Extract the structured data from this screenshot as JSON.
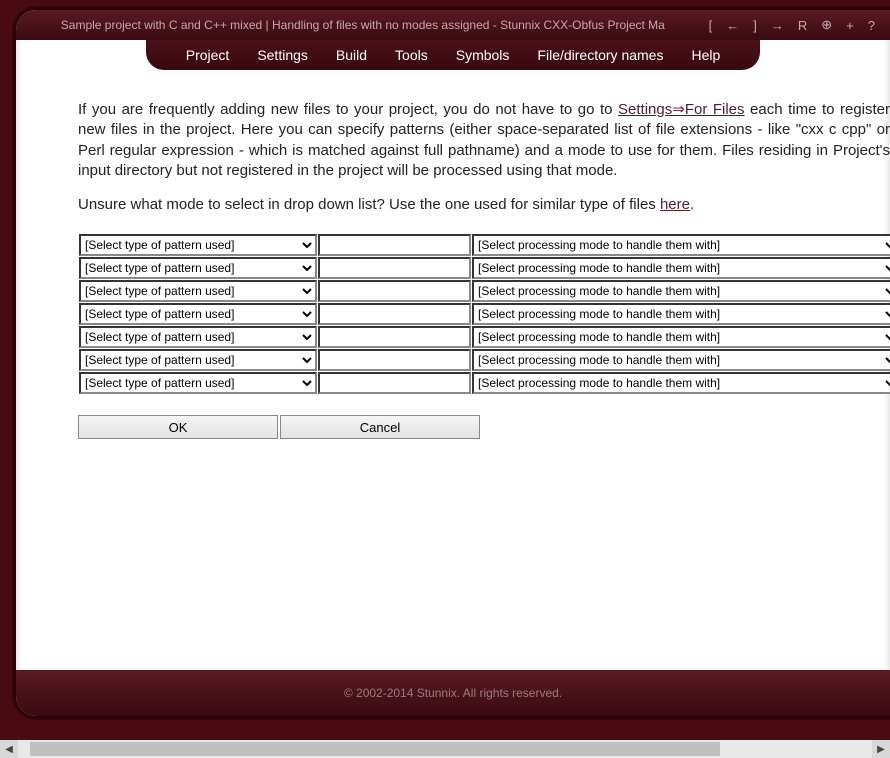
{
  "title": "Sample project with C and C++ mixed | Handling of files with no modes assigned - Stunnix CXX-Obfus Project Ma",
  "title_icons": [
    "[",
    "←",
    "]",
    "→",
    "R",
    "⊕",
    "+",
    "?"
  ],
  "menu": [
    "Project",
    "Settings",
    "Build",
    "Tools",
    "Symbols",
    "File/directory names",
    "Help"
  ],
  "para1_a": "If you are frequently adding new files to your project, you do not have to go to ",
  "para1_link": "Settings⇒For Files",
  "para1_b": " each time to register new files in the project. Here you can specify patterns (either space-separated list of file extensions - like \"cxx c cpp\" or Perl regular expression - which is matched against full pathname) and a mode to use for them. Files residing in Project's input directory but not registered in the project will be processed using that mode.",
  "para2_a": "Unsure what mode to select in drop down list? Use the one used for similar type of files ",
  "para2_link": "here",
  "para2_b": ".",
  "pattern_type_label": "[Select type of pattern used]",
  "mode_label": "[Select processing mode to handle them with]",
  "row_count": 7,
  "ok": "OK",
  "cancel": "Cancel",
  "footer": "© 2002-2014 Stunnix. All rights reserved."
}
